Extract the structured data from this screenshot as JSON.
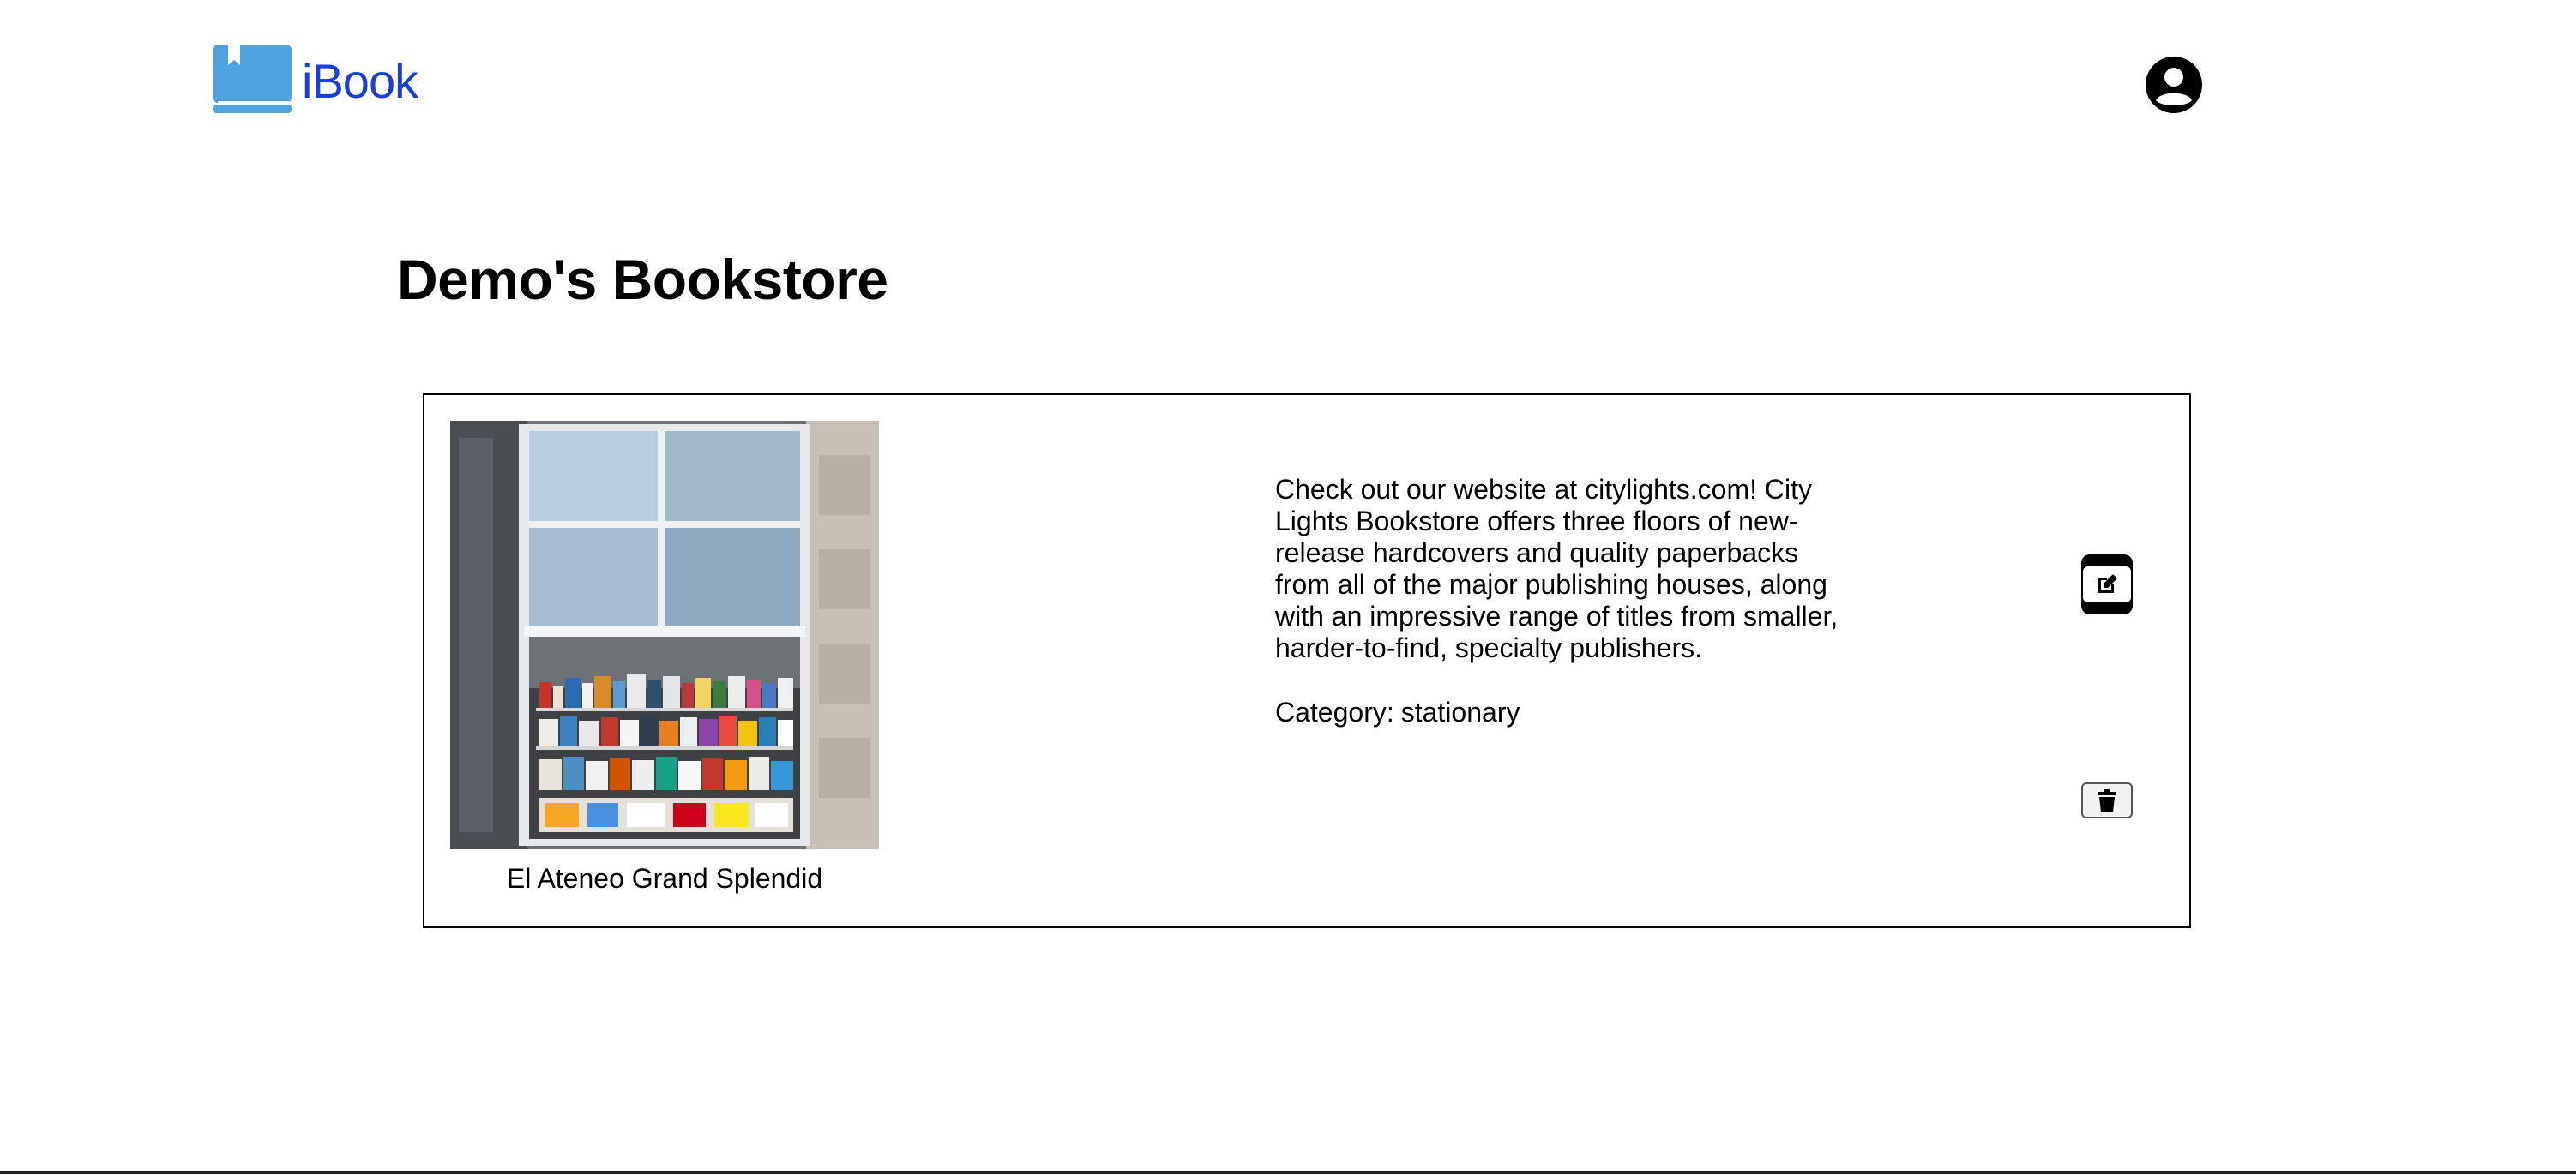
{
  "header": {
    "logo_text": "iBook",
    "logo_icon": "book-icon",
    "account_icon": "account-circle-icon"
  },
  "page": {
    "title": "Demo's Bookstore"
  },
  "store": {
    "image_alt": "storefront window with book display",
    "name": "El Ateneo Grand Splendid",
    "description": "Check out our website at citylights.com! City Lights Bookstore offers three floors of new-release hardcovers and quality paperbacks from all of the major publishing houses, along with an impressive range of titles from smaller, harder-to-find, specialty publishers.",
    "category_label": "Category:",
    "category_value": "stationary",
    "edit_icon": "edit-icon",
    "delete_icon": "trash-icon"
  },
  "colors": {
    "brand": "#1a3fd6",
    "logo_icon": "#4fa3e0"
  }
}
